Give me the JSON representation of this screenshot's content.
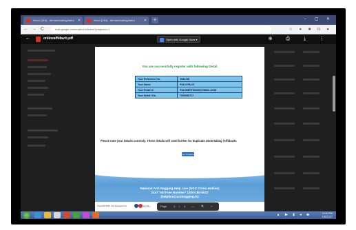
{
  "browser": {
    "tabs": [
      {
        "label": "Inbox (216) - farmanhadeogmail.c"
      },
      {
        "label": "Inbox (216) - farmanhadeogmail.c"
      }
    ],
    "new_tab": "+",
    "window_controls": "– ▢ ✕",
    "nav": {
      "back": "←",
      "forward": "→",
      "reload": "C"
    },
    "url": "mail.google.com/mail/u/1/#inbox?projector=1",
    "extensions": "☆ ● ■ ◘ ●"
  },
  "viewer": {
    "file_name": "onlineaffidavit.pdf",
    "open_with": "Open with Google Docs ▾",
    "actions": "⊕ ⎙ ⤓ ⋮"
  },
  "document": {
    "success_message": "You are successfully register with following Detail",
    "details": [
      {
        "label": "Your Reference No.",
        "value": "2054738"
      },
      {
        "label": "Your Name",
        "value": "PALVI PALVI"
      },
      {
        "label": "Your Email Id",
        "value": "PALVIMEHTA009@GMAIL.COM"
      },
      {
        "label": "Your Mobile No.",
        "value": "7009985717"
      }
    ],
    "note": "Please note your details correctly. These details will used further for duplicate Undertaking /Affidavits",
    "go_home": "Go To Home",
    "helpline": [
      "National Anti Ragging Help Line (UGC Crisis Hotline)",
      "24x7 Toll Free Number* 1800-180-5522",
      "(helpline@antiragging.in)"
    ],
    "copyright": "Copyright 2011. Site Developed by",
    "logo_text": "ACRI"
  },
  "page_controls": {
    "label": "Page",
    "current": "1",
    "separator": "/",
    "total": "1",
    "minus": "—",
    "zoom": "🔍",
    "plus": "+"
  },
  "taskbar": {
    "tray_time": "2:05 PM",
    "tray_date": "1/6/2017",
    "tray_icons": "▲ ▶ ▮ ◂ ◆"
  },
  "colors": {
    "success_green": "#2e9b2e",
    "table_fill": "#7fc4ea",
    "button_blue": "#2a6fc9",
    "help_band": "#5c9fd8"
  }
}
